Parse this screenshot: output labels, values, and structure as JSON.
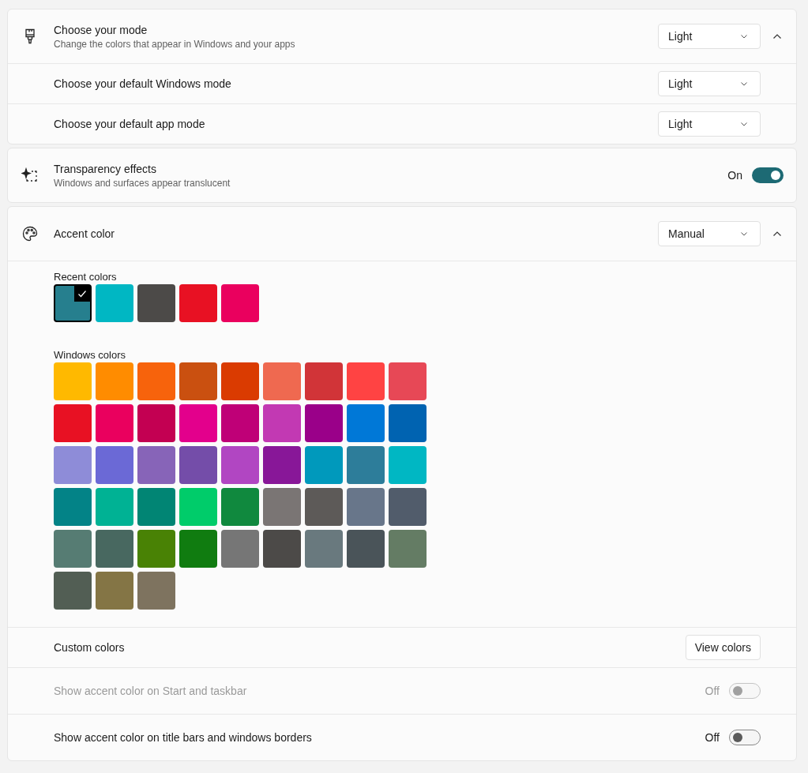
{
  "mode_card": {
    "title": "Choose your mode",
    "subtitle": "Change the colors that appear in Windows and your apps",
    "dropdown": {
      "value": "Light"
    },
    "expanded": true,
    "settings": [
      {
        "label": "Choose your default Windows mode",
        "dropdown": {
          "value": "Light"
        }
      },
      {
        "label": "Choose your default app mode",
        "dropdown": {
          "value": "Light"
        }
      }
    ]
  },
  "transparency": {
    "title": "Transparency effects",
    "subtitle": "Windows and surfaces appear translucent",
    "toggle": {
      "state_label": "On",
      "on": true
    }
  },
  "accent": {
    "title": "Accent color",
    "dropdown": {
      "value": "Manual"
    },
    "expanded": true,
    "recent_colors": {
      "label": "Recent colors",
      "swatches": [
        {
          "color": "#267f8e",
          "selected": true
        },
        {
          "color": "#00b7c3",
          "selected": false
        },
        {
          "color": "#4c4a48",
          "selected": false
        },
        {
          "color": "#e81123",
          "selected": false
        },
        {
          "color": "#ea005e",
          "selected": false
        }
      ]
    },
    "windows_colors": {
      "label": "Windows colors",
      "swatches": [
        {
          "color": "#ffb900",
          "selected": false
        },
        {
          "color": "#ff8c00",
          "selected": false
        },
        {
          "color": "#f7630c",
          "selected": false
        },
        {
          "color": "#ca5010",
          "selected": false
        },
        {
          "color": "#da3b01",
          "selected": false
        },
        {
          "color": "#ef6950",
          "selected": false
        },
        {
          "color": "#d13438",
          "selected": false
        },
        {
          "color": "#ff4343",
          "selected": false
        },
        {
          "color": "#e74856",
          "selected": false
        },
        {
          "color": "#e81123",
          "selected": false
        },
        {
          "color": "#ea005e",
          "selected": false
        },
        {
          "color": "#c30052",
          "selected": false
        },
        {
          "color": "#e3008c",
          "selected": false
        },
        {
          "color": "#bf0077",
          "selected": false
        },
        {
          "color": "#c239b3",
          "selected": false
        },
        {
          "color": "#9a0089",
          "selected": false
        },
        {
          "color": "#0078d7",
          "selected": false
        },
        {
          "color": "#0063b1",
          "selected": false
        },
        {
          "color": "#8e8cd8",
          "selected": false
        },
        {
          "color": "#6b69d6",
          "selected": false
        },
        {
          "color": "#8764b8",
          "selected": false
        },
        {
          "color": "#744da9",
          "selected": false
        },
        {
          "color": "#b146c2",
          "selected": false
        },
        {
          "color": "#881798",
          "selected": false
        },
        {
          "color": "#0099bc",
          "selected": false
        },
        {
          "color": "#2d7d9a",
          "selected": false
        },
        {
          "color": "#00b7c3",
          "selected": false
        },
        {
          "color": "#038387",
          "selected": false
        },
        {
          "color": "#00b294",
          "selected": false
        },
        {
          "color": "#018574",
          "selected": false
        },
        {
          "color": "#00cc6a",
          "selected": false
        },
        {
          "color": "#10893e",
          "selected": false
        },
        {
          "color": "#7a7574",
          "selected": false
        },
        {
          "color": "#5d5a58",
          "selected": false
        },
        {
          "color": "#68768a",
          "selected": false
        },
        {
          "color": "#515c6b",
          "selected": false
        },
        {
          "color": "#567c73",
          "selected": false
        },
        {
          "color": "#486860",
          "selected": false
        },
        {
          "color": "#498205",
          "selected": false
        },
        {
          "color": "#107c10",
          "selected": false
        },
        {
          "color": "#767676",
          "selected": false
        },
        {
          "color": "#4c4a48",
          "selected": false
        },
        {
          "color": "#69797e",
          "selected": false
        },
        {
          "color": "#4a5459",
          "selected": false
        },
        {
          "color": "#647c64",
          "selected": false
        },
        {
          "color": "#525e54",
          "selected": false
        },
        {
          "color": "#847545",
          "selected": false
        },
        {
          "color": "#7e735f",
          "selected": false
        }
      ]
    },
    "settings": [
      {
        "kind": "button",
        "label": "Custom colors",
        "button": "View colors"
      },
      {
        "kind": "toggle",
        "label": "Show accent color on Start and taskbar",
        "disabled": true,
        "state_label": "Off",
        "on": false
      },
      {
        "kind": "toggle",
        "label": "Show accent color on title bars and windows borders",
        "disabled": false,
        "state_label": "Off",
        "on": false
      }
    ]
  }
}
